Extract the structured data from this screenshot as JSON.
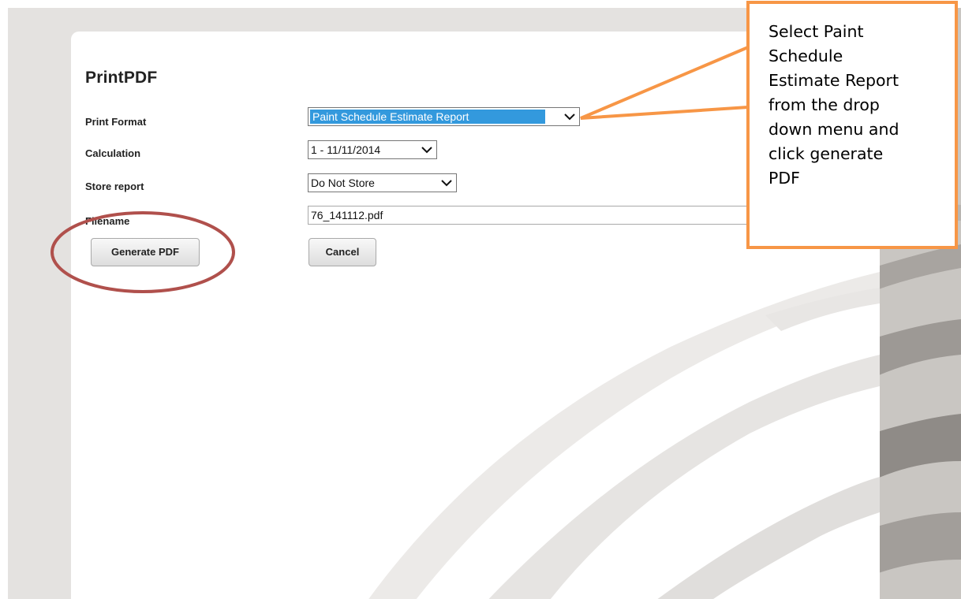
{
  "page": {
    "title": "PrintPDF"
  },
  "form": {
    "print_format": {
      "label": "Print Format",
      "value": "Paint Schedule Estimate Report"
    },
    "calculation": {
      "label": "Calculation",
      "value": "1 - 11/11/2014"
    },
    "store_report": {
      "label": "Store report",
      "value": "Do Not Store"
    },
    "filename": {
      "label": "Filename",
      "value": "76_141112.pdf"
    }
  },
  "buttons": {
    "generate": "Generate PDF",
    "cancel": "Cancel"
  },
  "annotation": {
    "callout_text": "Select Paint\nSchedule\nEstimate Report\nfrom the drop\ndown menu and\nclick generate\nPDF",
    "callout_color": "#f79646",
    "circle_color": "#b0504c"
  },
  "colors": {
    "selection_highlight": "#3399dd",
    "background": "#e4e2e0"
  }
}
